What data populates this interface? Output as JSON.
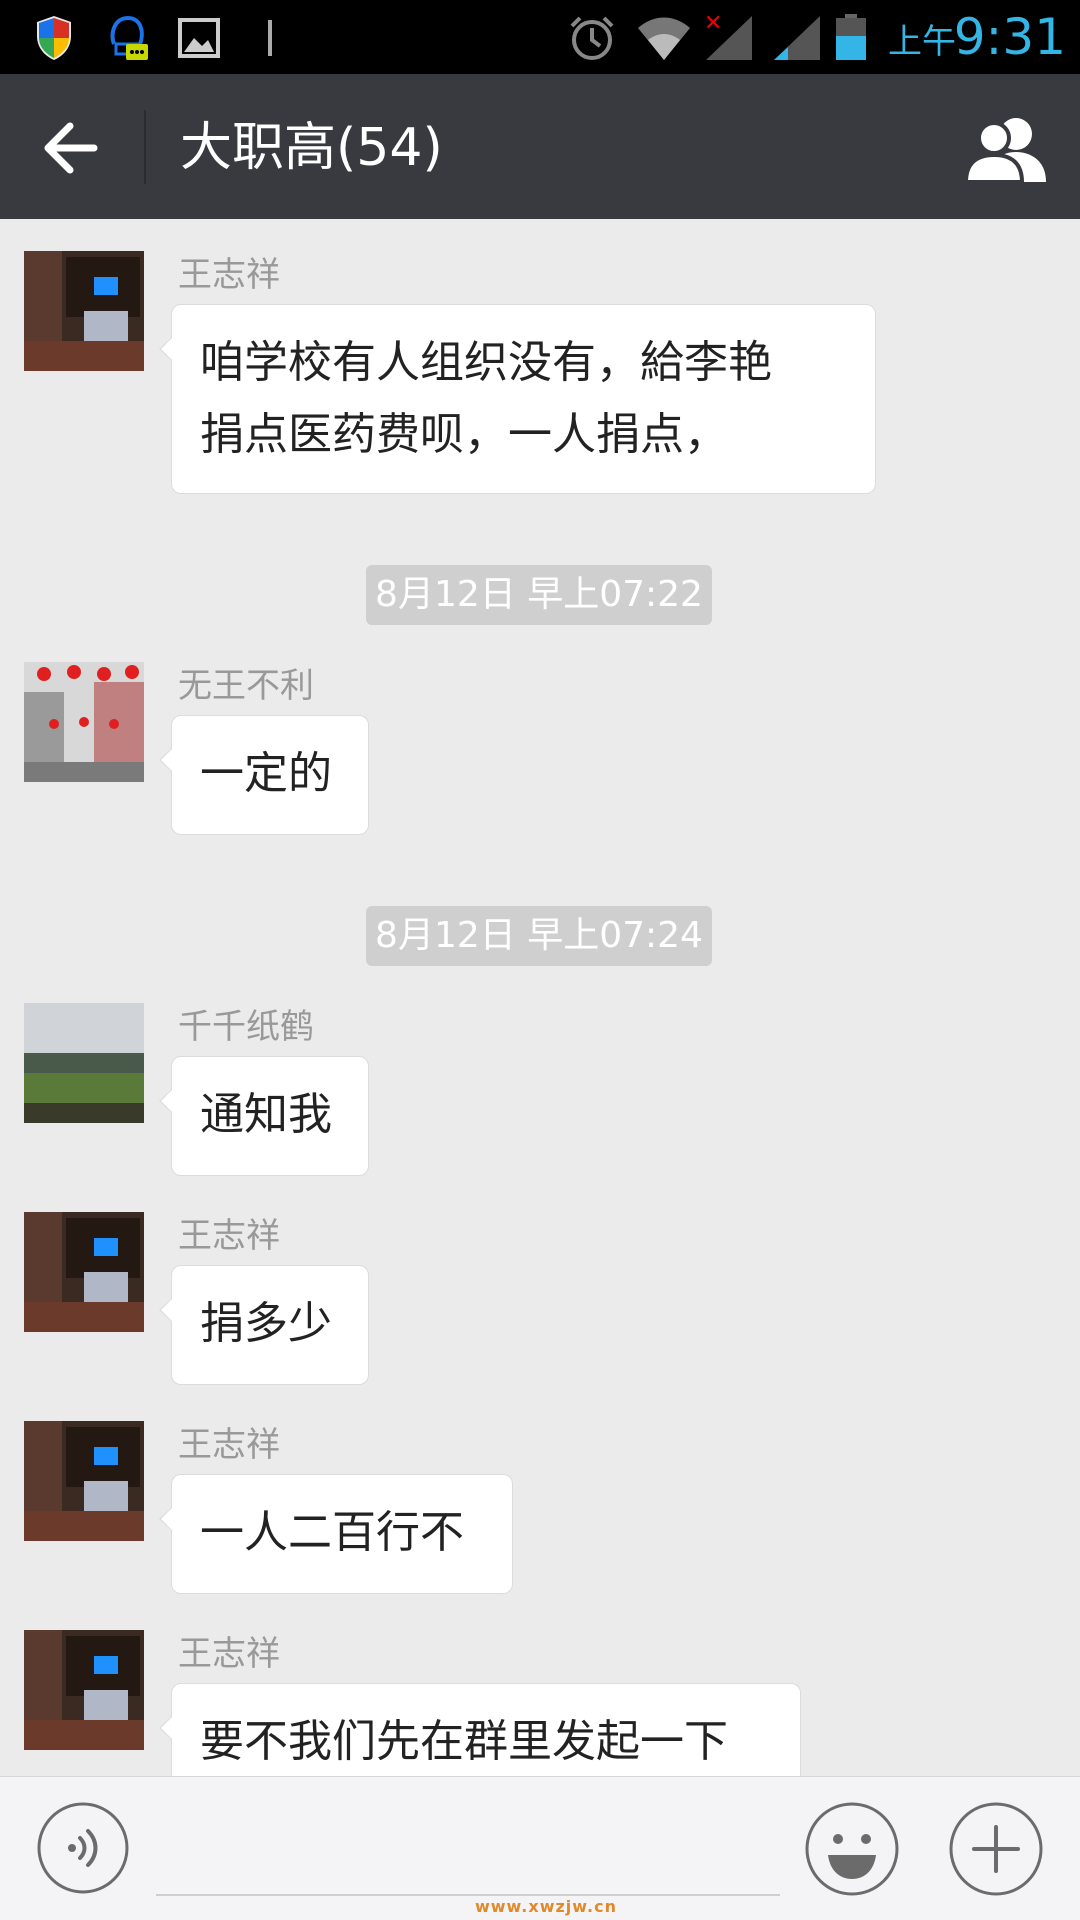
{
  "status_bar": {
    "ampm": "上午",
    "time": "9:31",
    "icons": [
      "shield-icon",
      "qq-message-icon",
      "gallery-icon",
      "cursor-icon",
      "alarm-icon",
      "wifi-icon",
      "signal-icon",
      "signal-icon",
      "battery-icon"
    ]
  },
  "header": {
    "title": "大职高(54)",
    "back_icon": "arrow-left-icon",
    "members_icon": "group-members-icon"
  },
  "chat": {
    "messages": [
      {
        "sender": "王志祥",
        "lines": [
          "咱学校有人组织没有，給李艳",
          "捐点医药费呗，一人捐点，"
        ]
      },
      {
        "sender": "无王不利",
        "lines": [
          "一定的"
        ]
      },
      {
        "sender": "千千纸鹤",
        "lines": [
          "通知我"
        ]
      },
      {
        "sender": "王志祥",
        "lines": [
          "捐多少"
        ]
      },
      {
        "sender": "王志祥",
        "lines": [
          "一人二百行不"
        ]
      },
      {
        "sender": "王志祥",
        "lines": [
          "要不我们先在群里发起一下"
        ]
      }
    ],
    "timestamps": [
      "8月12日 早上07:22",
      "8月12日 早上07:24"
    ]
  },
  "bottom_bar": {
    "voice_icon": "voice-icon",
    "emoji_icon": "emoji-icon",
    "plus_icon": "plus-icon",
    "watermark": "www.xwzjw.cn"
  },
  "colors": {
    "status_bar_bg": "#000000",
    "status_accent": "#33b5e5",
    "header_bg": "#393a3f",
    "chat_bg": "#ebebeb",
    "bubble_bg": "#ffffff",
    "timestamp_bg": "#cfcfcf"
  }
}
